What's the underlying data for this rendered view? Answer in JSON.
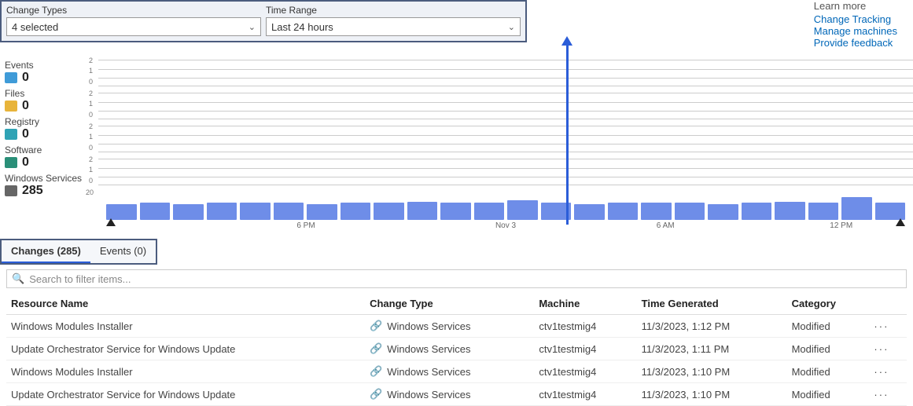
{
  "filters": {
    "change_types_label": "Change Types",
    "change_types_value": "4 selected",
    "time_range_label": "Time Range",
    "time_range_value": "Last 24 hours"
  },
  "learn": {
    "heading": "Learn more",
    "links": [
      "Change Tracking",
      "Manage machines",
      "Provide feedback"
    ]
  },
  "stats": [
    {
      "label": "Events",
      "value": "0",
      "icon": "events-icon",
      "color": "#3f9bd8"
    },
    {
      "label": "Files",
      "value": "0",
      "icon": "files-icon",
      "color": "#e8b43a"
    },
    {
      "label": "Registry",
      "value": "0",
      "icon": "registry-icon",
      "color": "#2fa3b5"
    },
    {
      "label": "Software",
      "value": "0",
      "icon": "software-icon",
      "color": "#2a8f78"
    },
    {
      "label": "Windows Services",
      "value": "285",
      "icon": "services-icon",
      "color": "#666"
    }
  ],
  "chart_data": [
    {
      "type": "bar",
      "title": "Events",
      "ylim": [
        0,
        2
      ],
      "yticks": [
        "2",
        "1",
        "0"
      ],
      "values": []
    },
    {
      "type": "bar",
      "title": "Files",
      "ylim": [
        0,
        2
      ],
      "yticks": [
        "2",
        "1",
        "0"
      ],
      "values": []
    },
    {
      "type": "bar",
      "title": "Registry",
      "ylim": [
        0,
        2
      ],
      "yticks": [
        "2",
        "1",
        "0"
      ],
      "values": []
    },
    {
      "type": "bar",
      "title": "Software",
      "ylim": [
        0,
        2
      ],
      "yticks": [
        "2",
        "1",
        "0"
      ],
      "values": []
    },
    {
      "type": "bar",
      "title": "Windows Services",
      "ylim": [
        0,
        20
      ],
      "yticks": [
        "20"
      ],
      "x_ticks": [
        "6 PM",
        "Nov 3",
        "6 AM",
        "12 PM"
      ],
      "values": [
        11,
        12,
        11,
        12,
        12,
        12,
        11,
        12,
        12,
        13,
        12,
        12,
        14,
        12,
        11,
        12,
        12,
        12,
        11,
        12,
        13,
        12,
        16,
        12
      ]
    }
  ],
  "tabs": {
    "changes": "Changes (285)",
    "events": "Events (0)"
  },
  "search_placeholder": "Search to filter items...",
  "columns": [
    "Resource Name",
    "Change Type",
    "Machine",
    "Time Generated",
    "Category"
  ],
  "rows": [
    {
      "name": "Windows Modules Installer",
      "ctype": "Windows Services",
      "machine": "ctv1testmig4",
      "time": "11/3/2023, 1:12 PM",
      "cat": "Modified"
    },
    {
      "name": "Update Orchestrator Service for Windows Update",
      "ctype": "Windows Services",
      "machine": "ctv1testmig4",
      "time": "11/3/2023, 1:11 PM",
      "cat": "Modified"
    },
    {
      "name": "Windows Modules Installer",
      "ctype": "Windows Services",
      "machine": "ctv1testmig4",
      "time": "11/3/2023, 1:10 PM",
      "cat": "Modified"
    },
    {
      "name": "Update Orchestrator Service for Windows Update",
      "ctype": "Windows Services",
      "machine": "ctv1testmig4",
      "time": "11/3/2023, 1:10 PM",
      "cat": "Modified"
    }
  ]
}
